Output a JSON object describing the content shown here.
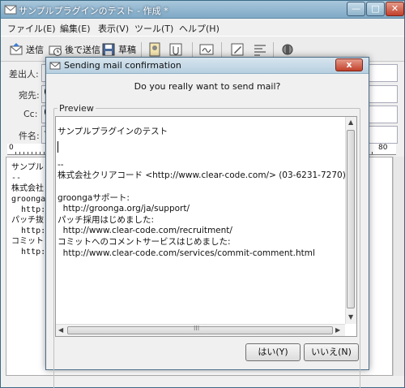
{
  "main_window": {
    "title": "サンプルプラグインのテスト - 作成 *",
    "buttons": {
      "minimize": "—",
      "maximize": "□",
      "close": "✕"
    }
  },
  "menu": [
    "ファイル(E)",
    "編集(E)",
    "表示(V)",
    "ツール(T)",
    "ヘルプ(H)"
  ],
  "toolbar": {
    "send": "送信",
    "send_later": "後で送信",
    "draft": "草稿"
  },
  "header_fields": {
    "from": "差出人:",
    "to": "宛先:",
    "cc": "Cc:",
    "subject": "件名:",
    "to_prefix": "(",
    "cc_prefix": "(",
    "subject_prefix": "サ"
  },
  "ruler": {
    "start": "0",
    "end": "80"
  },
  "body_lines": [
    "サンプル",
    "",
    "--",
    "株式会社",
    "",
    "groonga",
    "  http:",
    "パッチ抜",
    "  http:",
    "コミット",
    "  http:"
  ],
  "dialog": {
    "title": "Sending mail confirmation",
    "close": "x",
    "question": "Do you really want to send mail?",
    "preview_label": "Preview",
    "preview_lines": [
      "サンプルプラグインのテスト",
      "",
      "",
      "--",
      "株式会社クリアコード <http://www.clear-code.com/> (03-6231-7270)",
      "",
      "groongaサポート:",
      "  http://groonga.org/ja/support/",
      "パッチ採用はじめました:",
      "  http://www.clear-code.com/recruitment/",
      "コミットへのコメントサービスはじめました:",
      "  http://www.clear-code.com/services/commit-comment.html"
    ],
    "yes_button": "はい(Y)",
    "no_button": "いいえ(N)",
    "hscroll_thumb": "III"
  }
}
